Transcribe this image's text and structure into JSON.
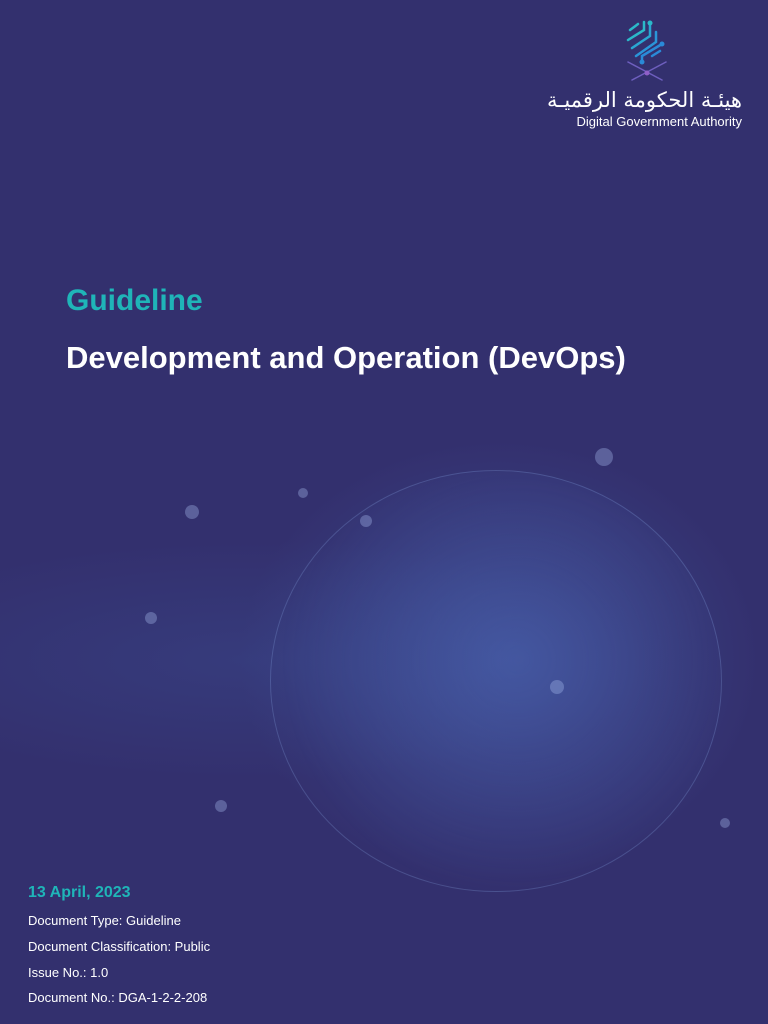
{
  "logo": {
    "arabic": "هيئـة الحكومة الرقميـة",
    "english": "Digital Government Authority"
  },
  "cover": {
    "label": "Guideline",
    "title": "Development and Operation (DevOps)"
  },
  "details": {
    "date": "13 April, 2023",
    "type": "Document Type: Guideline",
    "classification": "Document Classification: Public",
    "issue": "Issue No.: 1.0",
    "number": "Document No.: DGA-1-2-2-208"
  },
  "colors": {
    "background": "#33306e",
    "accent": "#1fb5b8"
  }
}
